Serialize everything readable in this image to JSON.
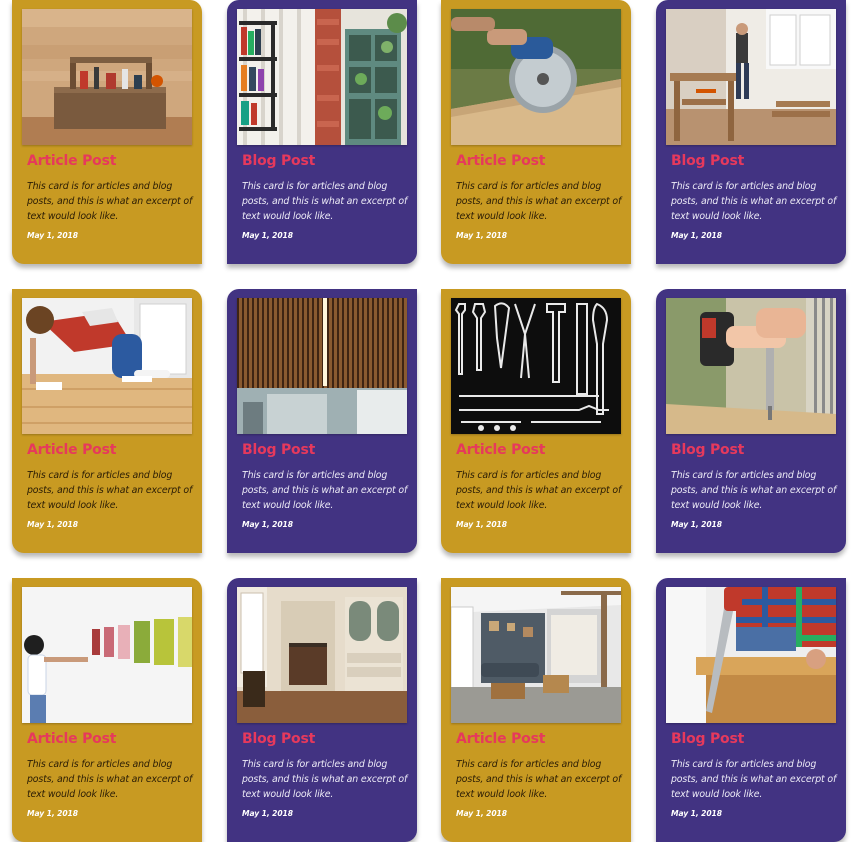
{
  "colors": {
    "article_bg": "#c89a22",
    "blog_bg": "#423382",
    "title": "#e6395c",
    "date": "#ffffff"
  },
  "cards": [
    {
      "type": "article",
      "title": "Article Post",
      "excerpt": "This card is for articles and blog posts, and this is what an excerpt of text would look like.",
      "date": "May 1, 2018",
      "image": "toolbox"
    },
    {
      "type": "blog",
      "title": "Blog Post",
      "excerpt": "This card is for articles and blog posts, and this is what an excerpt of text would look like.",
      "date": "May 1, 2018",
      "image": "pipe-shelves"
    },
    {
      "type": "article",
      "title": "Article Post",
      "excerpt": "This card is for articles and blog posts, and this is what an excerpt of text would look like.",
      "date": "May 1, 2018",
      "image": "circular-saw"
    },
    {
      "type": "blog",
      "title": "Blog Post",
      "excerpt": "This card is for articles and blog posts, and this is what an excerpt of text would look like.",
      "date": "May 1, 2018",
      "image": "woodshop"
    },
    {
      "type": "article",
      "title": "Article Post",
      "excerpt": "This card is for articles and blog posts, and this is what an excerpt of text would look like.",
      "date": "May 1, 2018",
      "image": "floor-cleaning"
    },
    {
      "type": "blog",
      "title": "Blog Post",
      "excerpt": "This card is for articles and blog posts, and this is what an excerpt of text would look like.",
      "date": "May 1, 2018",
      "image": "wood-slat-ceiling"
    },
    {
      "type": "article",
      "title": "Article Post",
      "excerpt": "This card is for articles and blog posts, and this is what an excerpt of text would look like.",
      "date": "May 1, 2018",
      "image": "tools-chalkboard"
    },
    {
      "type": "blog",
      "title": "Blog Post",
      "excerpt": "This card is for articles and blog posts, and this is what an excerpt of text would look like.",
      "date": "May 1, 2018",
      "image": "power-drill"
    },
    {
      "type": "article",
      "title": "Article Post",
      "excerpt": "This card is for articles and blog posts, and this is what an excerpt of text would look like.",
      "date": "May 1, 2018",
      "image": "paint-swatches"
    },
    {
      "type": "blog",
      "title": "Blog Post",
      "excerpt": "This card is for articles and blog posts, and this is what an excerpt of text would look like.",
      "date": "May 1, 2018",
      "image": "fireplace-room"
    },
    {
      "type": "article",
      "title": "Article Post",
      "excerpt": "This card is for articles and blog posts, and this is what an excerpt of text would look like.",
      "date": "May 1, 2018",
      "image": "living-room"
    },
    {
      "type": "blog",
      "title": "Blog Post",
      "excerpt": "This card is for articles and blog posts, and this is what an excerpt of text would look like.",
      "date": "May 1, 2018",
      "image": "hand-saw"
    }
  ]
}
